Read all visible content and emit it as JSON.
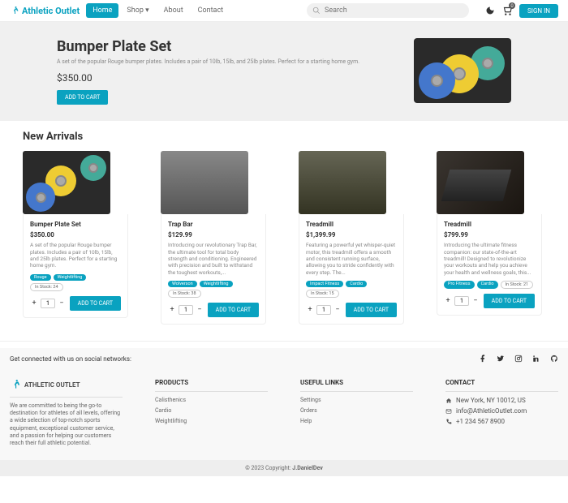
{
  "header": {
    "brand": "Athletic Outlet",
    "nav": {
      "home": "Home",
      "shop": "Shop",
      "about": "About",
      "contact": "Contact"
    },
    "search_placeholder": "Search",
    "signin": "SIGN IN",
    "cart_count": "0"
  },
  "hero": {
    "title": "Bumper Plate Set",
    "desc": "A set of the popular Rouge bumper plates. Includes a pair of 10lb, 15lb, and 25lb plates. Perfect for a starting home gym.",
    "price": "$350.00",
    "btn": "ADD TO CART"
  },
  "arrivals_title": "New Arrivals",
  "products": [
    {
      "name": "Bumper Plate Set",
      "price": "$350.00",
      "desc": "A set of the popular Rouge bumper plates. Includes a pair of 10lb, 15lb, and 25lb plates. Perfect for a starting home gym.",
      "tags": [
        "Rouge",
        "Weightlifting"
      ],
      "stock": "In Stock: 24",
      "qty": "1"
    },
    {
      "name": "Trap Bar",
      "price": "$129.99",
      "desc": "Introducing our revolutionary Trap Bar, the ultimate tool for total body strength and conditioning. Engineered with precision and built to withstand the toughest workouts,...",
      "tags": [
        "Wolverson",
        "Weightlifting"
      ],
      "stock": "In Stock: 38",
      "qty": "1"
    },
    {
      "name": "Treadmill",
      "price": "$1,399.99",
      "desc": "Featuring a powerful yet whisper-quiet motor, this treadmill offers a smooth and consistent running surface, allowing you to stride confidently with every step. The...",
      "tags": [
        "Impact Fitness",
        "Cardio"
      ],
      "stock": "In Stock: 15",
      "qty": "1"
    },
    {
      "name": "Treadmill",
      "price": "$799.99",
      "desc": "Introducing the ultimate fitness companion: our state-of-the-art treadmill! Designed to revolutionize your workouts and help you achieve your health and wellness goals, this...",
      "tags": [
        "Pro Fitness",
        "Cardio"
      ],
      "stock": "In Stock: 21",
      "qty": "1"
    }
  ],
  "social_text": "Get connected with us on social networks:",
  "footer": {
    "brand": "ATHLETIC OUTLET",
    "about": "We are committed to being the go-to destination for athletes of all levels, offering a wide selection of top-notch sports equipment, exceptional customer service, and a passion for helping our customers reach their full athletic potential.",
    "products_h": "PRODUCTS",
    "products": [
      "Calisthenics",
      "Cardio",
      "Weightlifting"
    ],
    "links_h": "USEFUL LINKS",
    "links": [
      "Settings",
      "Orders",
      "Help"
    ],
    "contact_h": "CONTACT",
    "address": "New York, NY 10012, US",
    "email": "info@AthleticOutlet.com",
    "phone": "+1 234 567 8900"
  },
  "copyright_prefix": "© 2023 Copyright: ",
  "copyright_name": "J.DanielDev"
}
